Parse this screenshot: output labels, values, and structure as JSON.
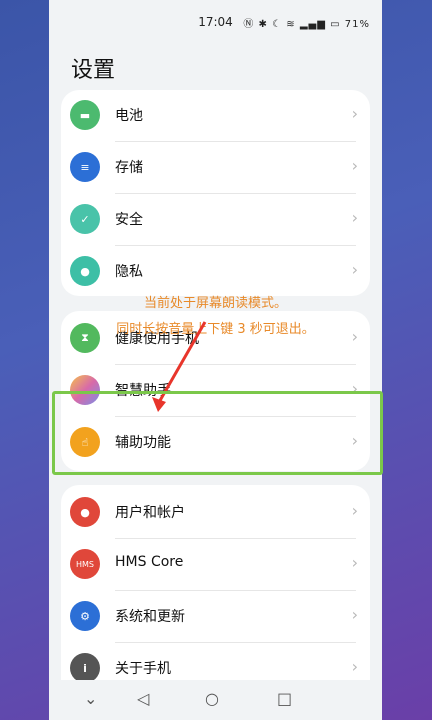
{
  "status": {
    "time": "17:04",
    "battery": "71%"
  },
  "page_title": "设置",
  "groups": [
    {
      "items": [
        {
          "label": "电池",
          "color": "#4cba6f",
          "icon": "battery-icon"
        },
        {
          "label": "存储",
          "color": "#2c6fd6",
          "icon": "storage-icon"
        },
        {
          "label": "安全",
          "color": "#49c3a9",
          "icon": "shield-icon"
        },
        {
          "label": "隐私",
          "color": "#3dbfa6",
          "icon": "privacy-icon"
        }
      ]
    },
    {
      "items": [
        {
          "label": "健康使用手机",
          "color": "#52b95e",
          "icon": "hourglass-icon"
        },
        {
          "label": "智慧助手",
          "color": "#d16aa8",
          "icon": "assistant-icon"
        },
        {
          "label": "辅助功能",
          "color": "#f2a21e",
          "icon": "hand-icon"
        }
      ]
    },
    {
      "items": [
        {
          "label": "用户和帐户",
          "color": "#e0473a",
          "icon": "user-icon"
        },
        {
          "label": "HMS Core",
          "color": "#e0473a",
          "icon": "hms-icon",
          "badge": "HMS"
        },
        {
          "label": "系统和更新",
          "color": "#2c6fd6",
          "icon": "gear-icon"
        },
        {
          "label": "关于手机",
          "color": "#555555",
          "icon": "info-icon"
        }
      ]
    }
  ],
  "overlay": {
    "line1": "当前处于屏幕朗读模式。",
    "line2": "同时长按音量上下键 3 秒可退出。"
  }
}
